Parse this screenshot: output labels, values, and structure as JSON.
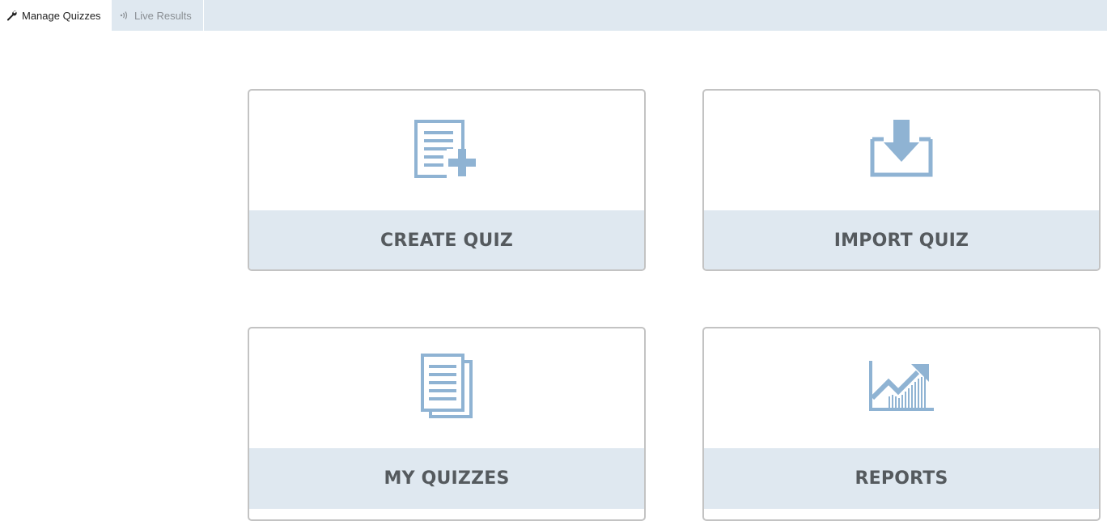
{
  "tabs": [
    {
      "label": "Manage Quizzes",
      "icon": "wrench-icon",
      "active": true
    },
    {
      "label": "Live Results",
      "icon": "broadcast-icon",
      "active": false
    }
  ],
  "cards": {
    "create": {
      "label": "CREATE QUIZ",
      "icon": "document-add-icon"
    },
    "import": {
      "label": "IMPORT QUIZ",
      "icon": "download-tray-icon"
    },
    "my_quizzes": {
      "label": "MY QUIZZES",
      "icon": "documents-stack-icon"
    },
    "reports": {
      "label": "REPORTS",
      "icon": "chart-growth-icon"
    }
  },
  "colors": {
    "accent_icon": "#8fb3d3",
    "tab_bar": "#dfe8f0",
    "label_text": "#555a5e"
  }
}
